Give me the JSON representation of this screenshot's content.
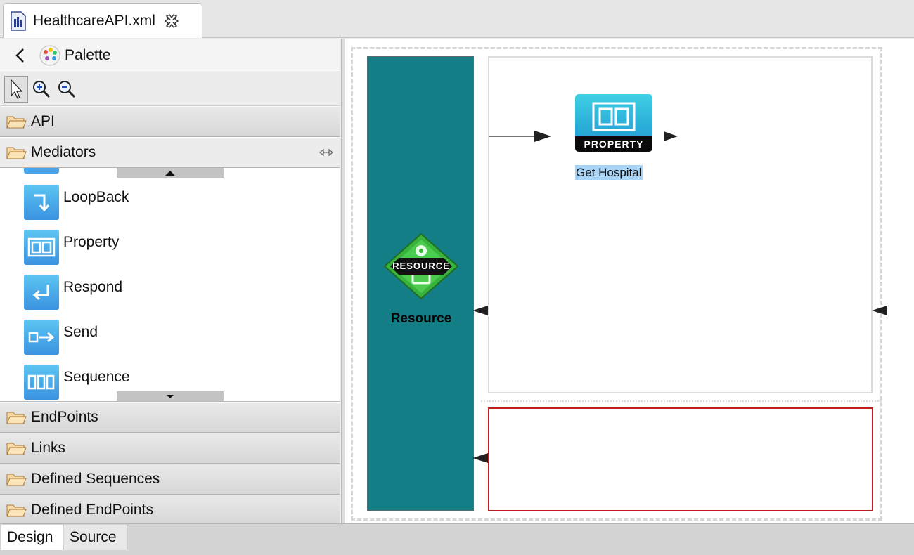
{
  "editor_tab": {
    "label": "HealthcareAPI.xml",
    "file_icon": "xml-file-icon",
    "close_icon": "close-icon"
  },
  "palette": {
    "title": "Palette",
    "tools": [
      {
        "name": "select-arrow-icon"
      },
      {
        "name": "zoom-in-icon"
      },
      {
        "name": "zoom-out-icon"
      }
    ],
    "drawers": {
      "api": "API",
      "mediators": "Mediators",
      "endpoints": "EndPoints",
      "links": "Links",
      "defined_sequences": "Defined Sequences",
      "defined_endpoints": "Defined EndPoints"
    },
    "mediators": [
      {
        "label": "LoopBack",
        "icon": "loopback-icon"
      },
      {
        "label": "Property",
        "icon": "property-icon"
      },
      {
        "label": "Respond",
        "icon": "respond-icon"
      },
      {
        "label": "Send",
        "icon": "send-icon"
      },
      {
        "label": "Sequence",
        "icon": "sequence-icon"
      }
    ]
  },
  "canvas": {
    "resource_label": "Resource",
    "resource_badge": "RESOURCE",
    "property_badge": "PROPERTY",
    "property_caption": "Get Hospital"
  },
  "bottom_tabs": {
    "design": "Design",
    "source": "Source"
  },
  "colors": {
    "resource_column": "#137e85",
    "fault_border": "#c21e1e",
    "mediator_blue": "#3a92e0",
    "selection": "#a8d4f7"
  }
}
